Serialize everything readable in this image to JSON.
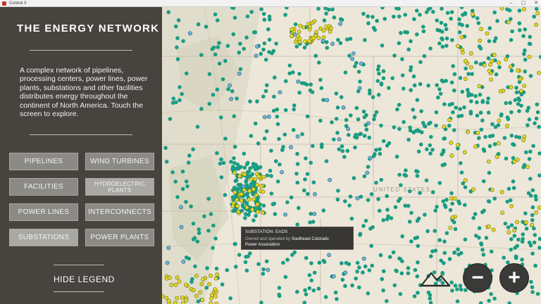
{
  "window": {
    "title": "Control II",
    "controls": {
      "minimize": "–",
      "maximize": "▢",
      "close": "✕"
    }
  },
  "legend": {
    "title": "THE ENERGY NETWORK",
    "description": "A complex network of pipelines, processing centers, power lines, power plants, substations and other facilities distributes energy throughout the continent of North America. Touch the screen to explore.",
    "buttons": [
      {
        "label": "PIPELINES",
        "active": false
      },
      {
        "label": "WIND TURBINES",
        "active": false
      },
      {
        "label": "FACILITIES",
        "active": false
      },
      {
        "label": "HYDROELECTRIC PLANTS",
        "active": true
      },
      {
        "label": "POWER LINES",
        "active": false
      },
      {
        "label": "INTERCONNECTS",
        "active": false
      },
      {
        "label": "SUBSTATIONS",
        "active": true
      },
      {
        "label": "POWER PLANTS",
        "active": false
      }
    ],
    "hide_label": "HIDE LEGEND"
  },
  "map": {
    "labels": {
      "united_states": "UNITED STATES"
    },
    "colors": {
      "substation": "#1a9c82",
      "power_plant": "#e3d926",
      "hydro": "#6fb4d6",
      "land": "#ece7d9"
    }
  },
  "tooltip": {
    "title": "SUBSTATION: EADS",
    "line_prefix": "Owned and operated by",
    "owner_part1": "Southeast Colorado",
    "owner_part2": "Power Association"
  },
  "controls": {
    "zoom_out": "−",
    "zoom_in": "+",
    "home_icon": "mountain-home-icon"
  }
}
